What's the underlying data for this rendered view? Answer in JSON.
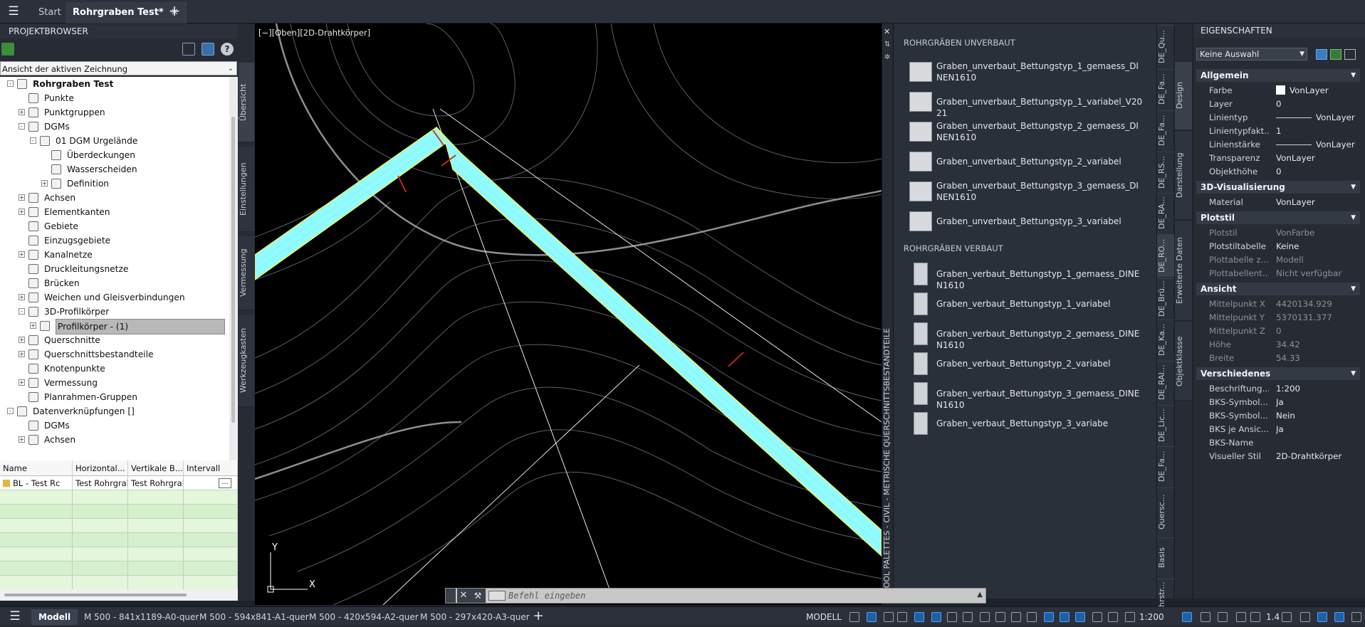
{
  "tabs": {
    "start": "Start",
    "active": "Rohrgraben Test*",
    "close": "✕",
    "add": "+"
  },
  "browser": {
    "title": "PROJEKTBROWSER",
    "view_select": "Ansicht der aktiven Zeichnung",
    "tree": [
      {
        "label": "Rohrgraben Test",
        "level": 0,
        "exp": "-",
        "bold": true
      },
      {
        "label": "Punkte",
        "level": 1,
        "exp": ""
      },
      {
        "label": "Punktgruppen",
        "level": 1,
        "exp": "+"
      },
      {
        "label": "DGMs",
        "level": 1,
        "exp": "-"
      },
      {
        "label": "01 DGM Urgelände",
        "level": 2,
        "exp": "-"
      },
      {
        "label": "Überdeckungen",
        "level": 3,
        "exp": ""
      },
      {
        "label": "Wasserscheiden",
        "level": 3,
        "exp": ""
      },
      {
        "label": "Definition",
        "level": 3,
        "exp": "+"
      },
      {
        "label": "Achsen",
        "level": 1,
        "exp": "+"
      },
      {
        "label": "Elementkanten",
        "level": 1,
        "exp": "+"
      },
      {
        "label": "Gebiete",
        "level": 1,
        "exp": ""
      },
      {
        "label": "Einzugsgebiete",
        "level": 1,
        "exp": ""
      },
      {
        "label": "Kanalnetze",
        "level": 1,
        "exp": "+"
      },
      {
        "label": "Druckleitungsnetze",
        "level": 1,
        "exp": ""
      },
      {
        "label": "Brücken",
        "level": 1,
        "exp": ""
      },
      {
        "label": "Weichen und Gleisverbindungen",
        "level": 1,
        "exp": "+"
      },
      {
        "label": "3D-Profilkörper",
        "level": 1,
        "exp": "-"
      },
      {
        "label": "Profilkörper - (1)",
        "level": 2,
        "exp": "+",
        "selected": true
      },
      {
        "label": "Querschnitte",
        "level": 1,
        "exp": "+"
      },
      {
        "label": "Querschnittsbestandteile",
        "level": 1,
        "exp": "+"
      },
      {
        "label": "Knotenpunkte",
        "level": 1,
        "exp": ""
      },
      {
        "label": "Vermessung",
        "level": 1,
        "exp": "+"
      },
      {
        "label": "Planrahmen-Gruppen",
        "level": 1,
        "exp": ""
      },
      {
        "label": "Datenverknüpfungen []",
        "level": 0,
        "exp": "-"
      },
      {
        "label": "DGMs",
        "level": 1,
        "exp": ""
      },
      {
        "label": "Achsen",
        "level": 1,
        "exp": "+"
      }
    ],
    "side_tabs": [
      "Übersicht",
      "Einstellungen",
      "Vermessung",
      "Werkzeugkasten"
    ]
  },
  "grid": {
    "headers": [
      "Name",
      "Horizontal...",
      "Vertikale B...",
      "Intervall"
    ],
    "row": [
      "BL - Test Rc",
      "Test Rohrgrab",
      "Test Rohrgrab",
      "..."
    ]
  },
  "viewport": {
    "label": "[−][Oben][2D-Drahtkörper]",
    "y_axis": "Y",
    "x_axis": "X"
  },
  "palette": {
    "vertical_title": "TOOL PALETTES - CIVIL - METRISCHE QUERSCHNITTSBESTANDTEILE",
    "close": "✕",
    "group1": "ROHRGRÄBEN UNVERBAUT",
    "items1": [
      "Graben_unverbaut_Bettungstyp_1_gemaess_DINEN1610",
      "Graben_unverbaut_Bettungstyp_1_variabel_V2021",
      "Graben_unverbaut_Bettungstyp_2_gemaess_DINEN1610",
      "Graben_unverbaut_Bettungstyp_2_variabel",
      "Graben_unverbaut_Bettungstyp_3_gemaess_DINEN1610",
      "Graben_unverbaut_Bettungstyp_3_variabel"
    ],
    "group2": "ROHRGRÄBEN VERBAUT",
    "items2": [
      "Graben_verbaut_Bettungstyp_1_gemaess_DINEN1610",
      "Graben_verbaut_Bettungstyp_1_variabel",
      "Graben_verbaut_Bettungstyp_2_gemaess_DINEN1610",
      "Graben_verbaut_Bettungstyp_2_variabel",
      "Graben_verbaut_Bettungstyp_3_gemaess_DINEN1610",
      "Graben_verbaut_Bettungstyp_3_variabe"
    ],
    "tabs": [
      "DE_Qu...",
      "DE_Fa...",
      "DE_Fa...",
      "DE_RS...",
      "DE_RA...",
      "DE_RO...",
      "DE_Brü...",
      "DE_Ka...",
      "DE_RAI...",
      "DE_Lic...",
      "DE_Fa...",
      "Quersc...",
      "Basis",
      "Fahrstr..."
    ]
  },
  "props": {
    "title": "EIGENSCHAFTEN",
    "selection": "Keine Auswahl",
    "side_tabs": [
      "Design",
      "Darstellung",
      "Erweiterte Daten",
      "Objektklasse"
    ],
    "categories": [
      {
        "name": "Allgemein",
        "rows": [
          {
            "k": "Farbe",
            "v": "VonLayer",
            "sw": "#ffffff"
          },
          {
            "k": "Layer",
            "v": "0"
          },
          {
            "k": "Linientyp",
            "v": "VonLayer",
            "line": true
          },
          {
            "k": "Linientypfakt...",
            "v": "1"
          },
          {
            "k": "Linienstärke",
            "v": "VonLayer",
            "line": true
          },
          {
            "k": "Transparenz",
            "v": "VonLayer"
          },
          {
            "k": "Objekthöhe",
            "v": "0"
          }
        ]
      },
      {
        "name": "3D-Visualisierung",
        "rows": [
          {
            "k": "Material",
            "v": "VonLayer"
          }
        ]
      },
      {
        "name": "Plotstil",
        "rows": [
          {
            "k": "Plotstil",
            "v": "VonFarbe",
            "dim": true
          },
          {
            "k": "Plotstiltabelle",
            "v": "Keine"
          },
          {
            "k": "Plottabelle z...",
            "v": "Modell",
            "dim": true
          },
          {
            "k": "Plottabellent...",
            "v": "Nicht verfügbar",
            "dim": true
          }
        ]
      },
      {
        "name": "Ansicht",
        "rows": [
          {
            "k": "Mittelpunkt X",
            "v": "4420134.929",
            "dim": true
          },
          {
            "k": "Mittelpunkt Y",
            "v": "5370131.377",
            "dim": true
          },
          {
            "k": "Mittelpunkt Z",
            "v": "0",
            "dim": true
          },
          {
            "k": "Höhe",
            "v": "34.42",
            "dim": true
          },
          {
            "k": "Breite",
            "v": "54.33",
            "dim": true
          }
        ]
      },
      {
        "name": "Verschiedenes",
        "rows": [
          {
            "k": "Beschriftung...",
            "v": "1:200"
          },
          {
            "k": "BKS-Symbol...",
            "v": "Ja"
          },
          {
            "k": "BKS-Symbol...",
            "v": "Nein"
          },
          {
            "k": "BKS je Ansic...",
            "v": "Ja"
          },
          {
            "k": "BKS-Name",
            "v": ""
          },
          {
            "k": "Visueller Stil",
            "v": "2D-Drahtkörper"
          }
        ]
      }
    ]
  },
  "command": {
    "placeholder": "Befehl eingeben"
  },
  "status": {
    "layouts": [
      "Modell",
      "M 500 - 841x1189-A0-quer",
      "M 500 - 594x841-A1-quer",
      "M 500 - 420x594-A2-quer",
      "M 500 - 297x420-A3-quer"
    ],
    "add": "+",
    "model": "MODELL",
    "scale": "1:200",
    "value": "1.4"
  },
  "colors": {
    "trench": "#8ffcff",
    "accent": "#4aa3ff"
  }
}
